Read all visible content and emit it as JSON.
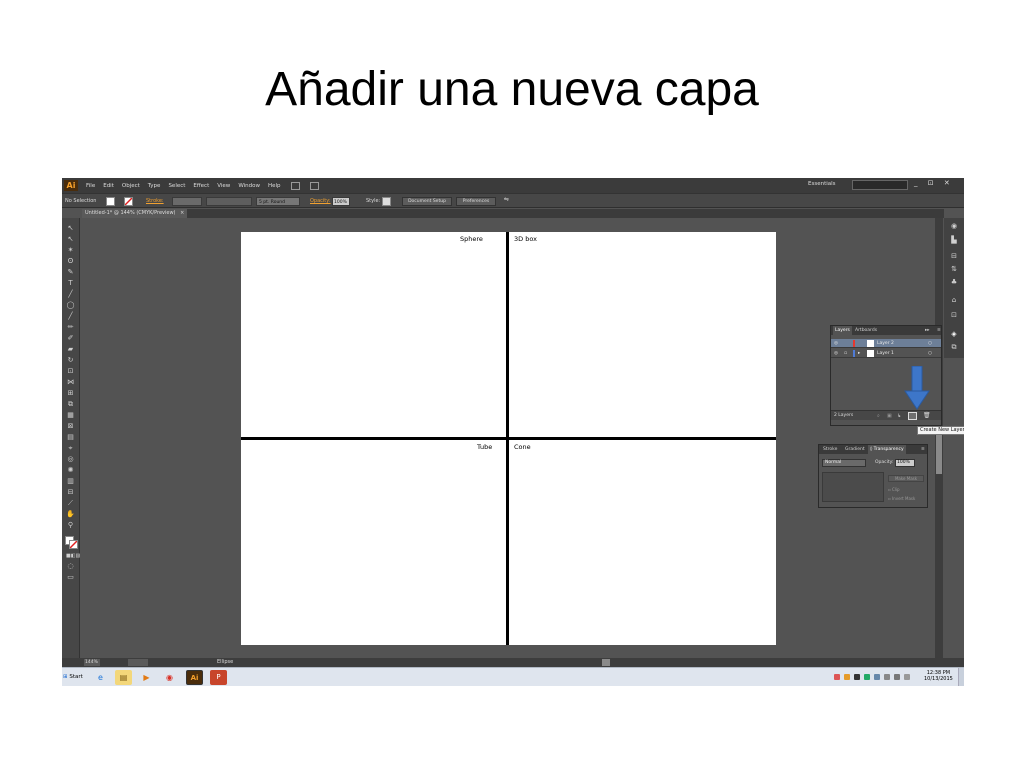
{
  "slide": {
    "title": "Añadir una nueva capa"
  },
  "app": {
    "logo": "Ai",
    "menu": [
      "File",
      "Edit",
      "Object",
      "Type",
      "Select",
      "Effect",
      "View",
      "Window",
      "Help"
    ],
    "workspace": "Essentials",
    "window_buttons": "_ ⊡ ✕"
  },
  "control_bar": {
    "selection": "No Selection",
    "stroke_label": "Stroke:",
    "brush": "5 pt. Round",
    "opacity_label": "Opacity:",
    "opacity_value": "100%",
    "style_label": "Style:",
    "document_setup": "Document Setup",
    "preferences": "Preferences"
  },
  "document": {
    "tab": "Untitled-1* @ 144% (CMYK/Preview)",
    "close": "×",
    "quadrants": [
      "Sphere",
      "3D box",
      "Tube",
      "Cone"
    ]
  },
  "status_bar": {
    "zoom": "144%",
    "tool": "Ellipse"
  },
  "layers_panel": {
    "tabs": [
      "Layers",
      "Artboards"
    ],
    "layers": [
      {
        "name": "Layer 2",
        "color": "#e8372f",
        "selected": true
      },
      {
        "name": "Layer 1",
        "color": "#4f7bd6",
        "selected": false
      }
    ],
    "count": "2 Layers",
    "tooltip": "Create New Layer",
    "highlight_color": "#3d76c9"
  },
  "transparency_panel": {
    "tabs": [
      "Stroke",
      "Gradient",
      "◊ Transparency"
    ],
    "blend_mode": "Normal",
    "opacity_label": "Opacity:",
    "opacity_value": "100%",
    "make_mask": "Make Mask",
    "clip": "Clip",
    "invert_mask": "Invert Mask"
  },
  "taskbar": {
    "start": "Start",
    "time": "12:38 PM",
    "date": "10/13/2015"
  }
}
